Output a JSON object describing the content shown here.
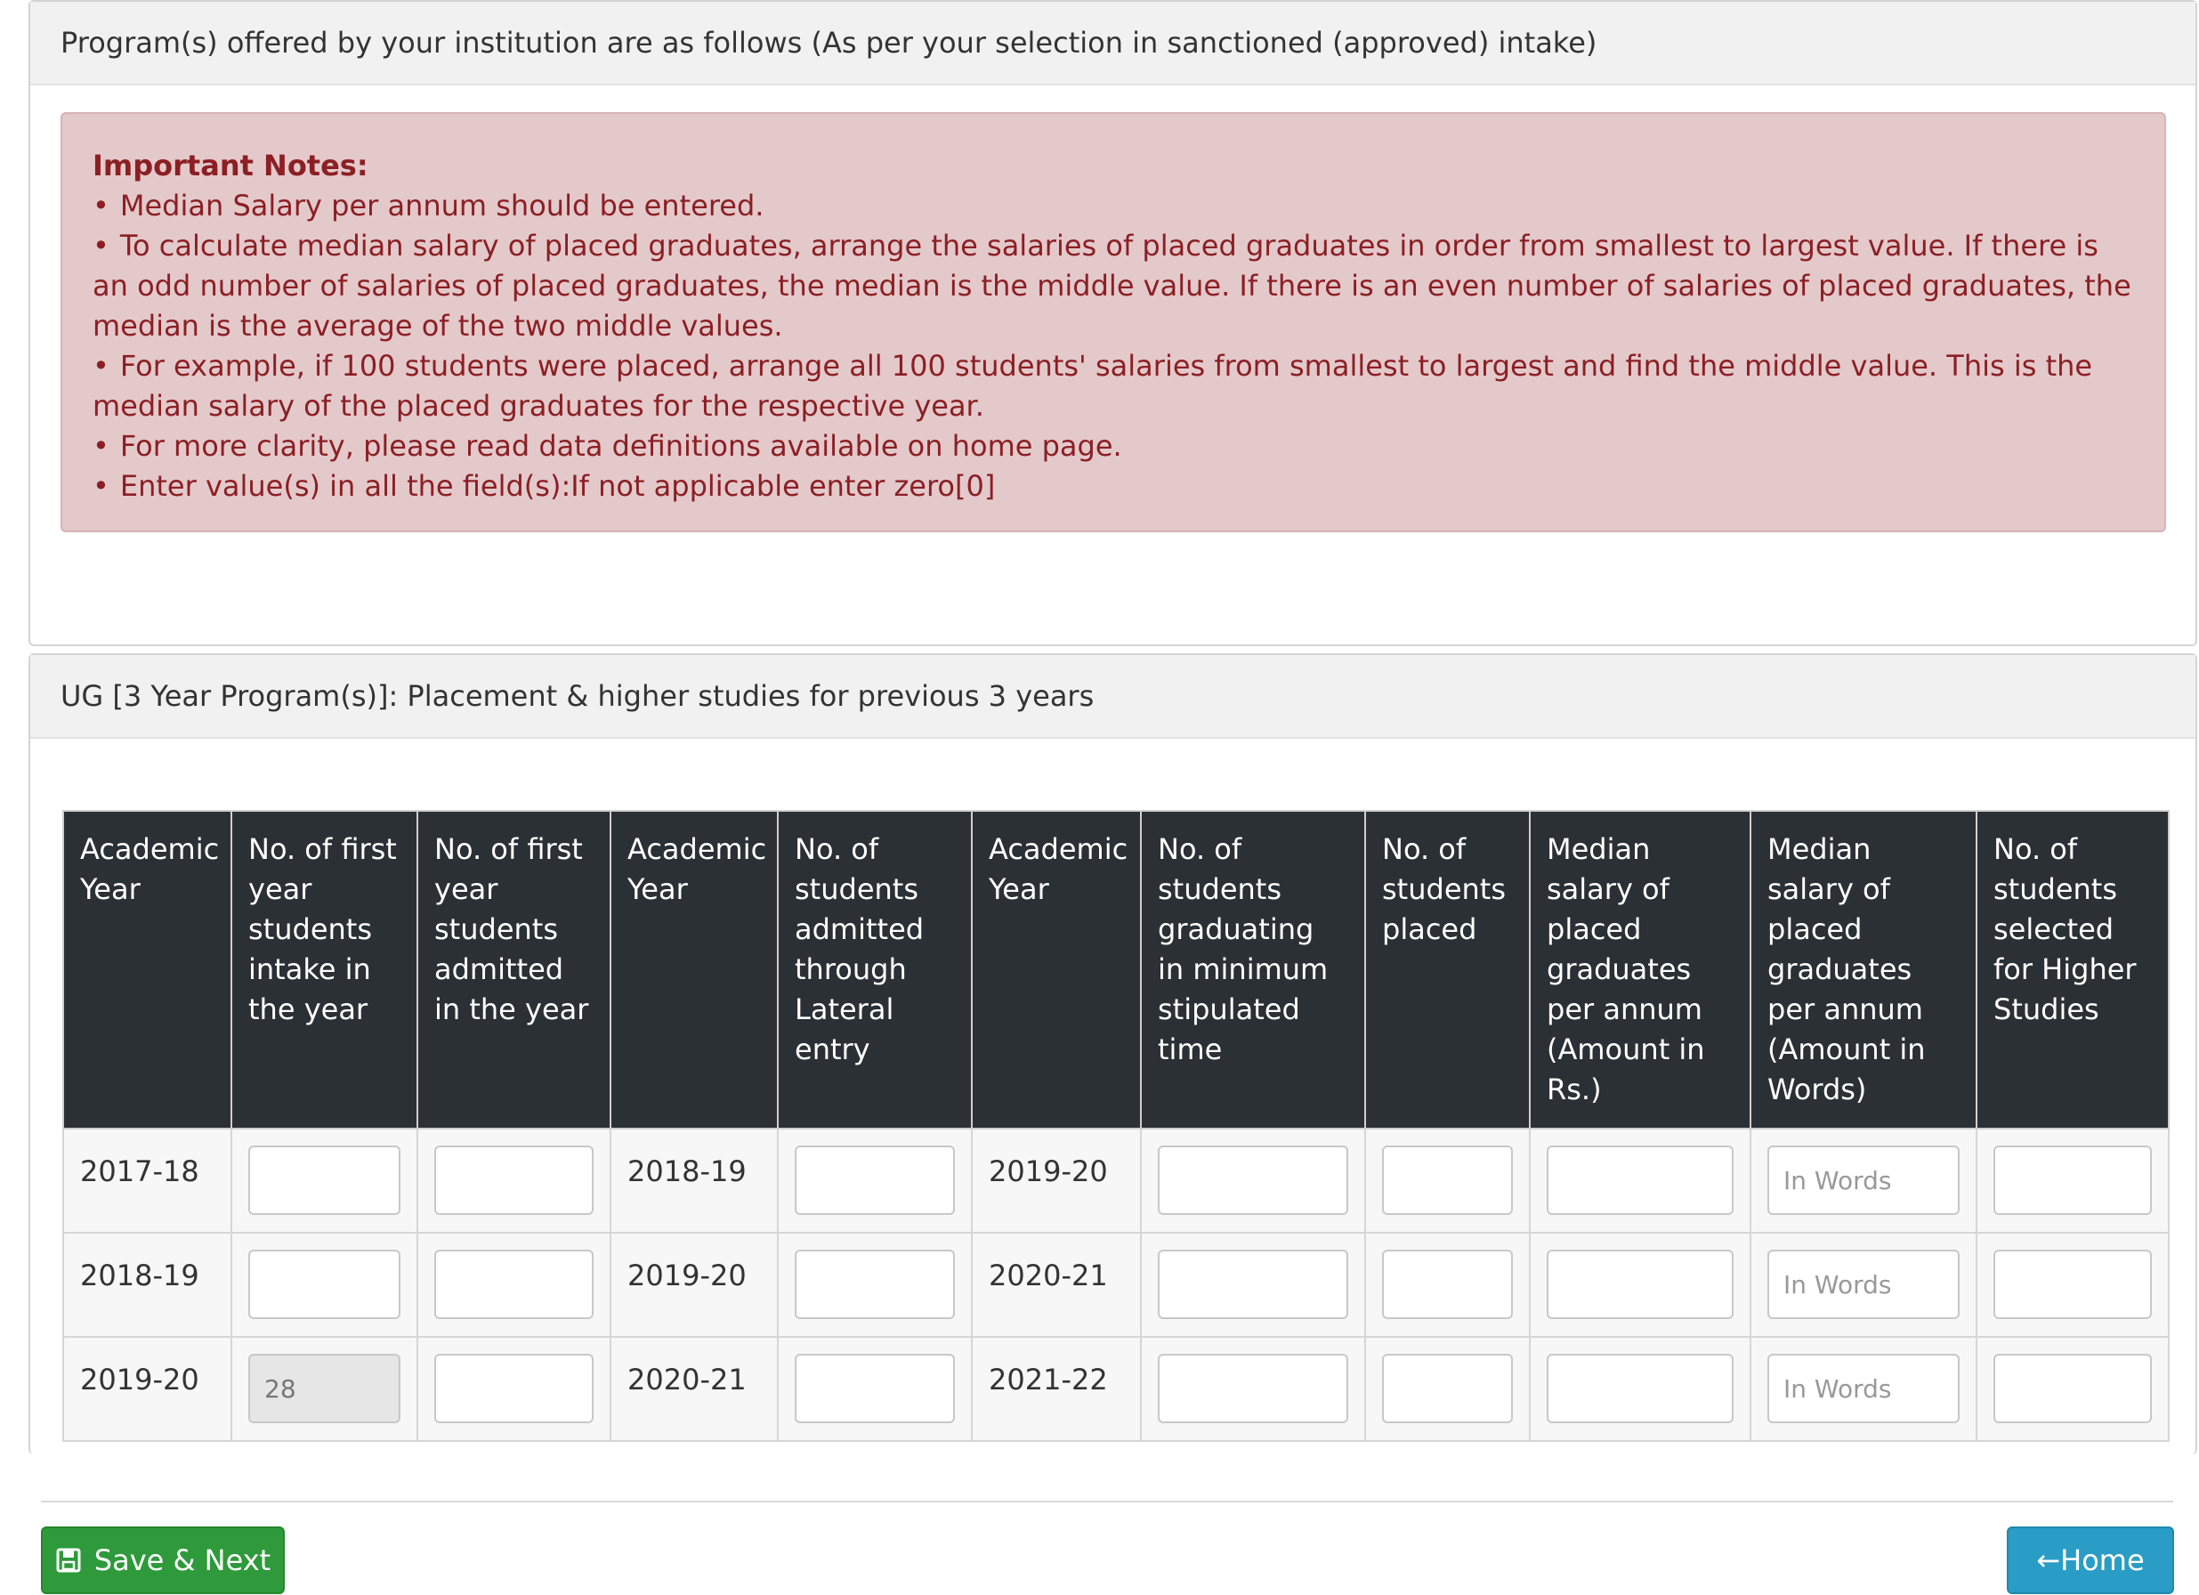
{
  "programs_panel": {
    "heading": "Program(s) offered by your institution are as follows (As per your selection in sanctioned (approved) intake)",
    "notes_title": "Important Notes:",
    "notes": [
      "Median Salary per annum should be entered.",
      "To calculate median salary of placed graduates, arrange the salaries of placed graduates in order from smallest to largest value. If there is an odd number of salaries of placed graduates, the median is the middle value. If there is an even number of salaries of placed graduates, the median is the average of the two middle values.",
      "For example, if 100 students were placed, arrange all 100 students' salaries from smallest to largest and find the middle value. This is the median salary of the placed graduates for the respective year.",
      "For more clarity, please read data definitions available on home page.",
      "Enter value(s) in all the field(s):If not applicable enter zero[0]"
    ]
  },
  "ug_panel": {
    "heading": "UG [3 Year Program(s)]: Placement & higher studies for previous 3 years",
    "columns": [
      "Academic Year",
      "No. of first year students intake in the year",
      "No. of first year students admitted in the year",
      "Academic Year",
      "No. of students admitted through Lateral entry",
      "Academic Year",
      "No. of students graduating in minimum stipulated time",
      "No. of students placed",
      "Median salary of placed graduates per annum (Amount in Rs.)",
      "Median salary of placed graduates per annum (Amount in Words)",
      "No. of students selected for Higher Studies"
    ],
    "words_placeholder": "In Words",
    "rows": [
      {
        "year1": "2017-18",
        "intake": "",
        "year2": "2018-19",
        "year3": "2019-20"
      },
      {
        "year1": "2018-19",
        "intake": "",
        "year2": "2019-20",
        "year3": "2020-21"
      },
      {
        "year1": "2019-20",
        "intake": "28",
        "year2": "2020-21",
        "year3": "2021-22"
      }
    ]
  },
  "footer": {
    "save_label": "Save & Next",
    "home_label": "←Home"
  },
  "colors": {
    "header_bg": "#2b3035",
    "notes_bg": "#e4c9cb",
    "notes_text": "#8b1f24",
    "save_bg": "#2e9a3b",
    "home_bg": "#2a9dc6"
  }
}
